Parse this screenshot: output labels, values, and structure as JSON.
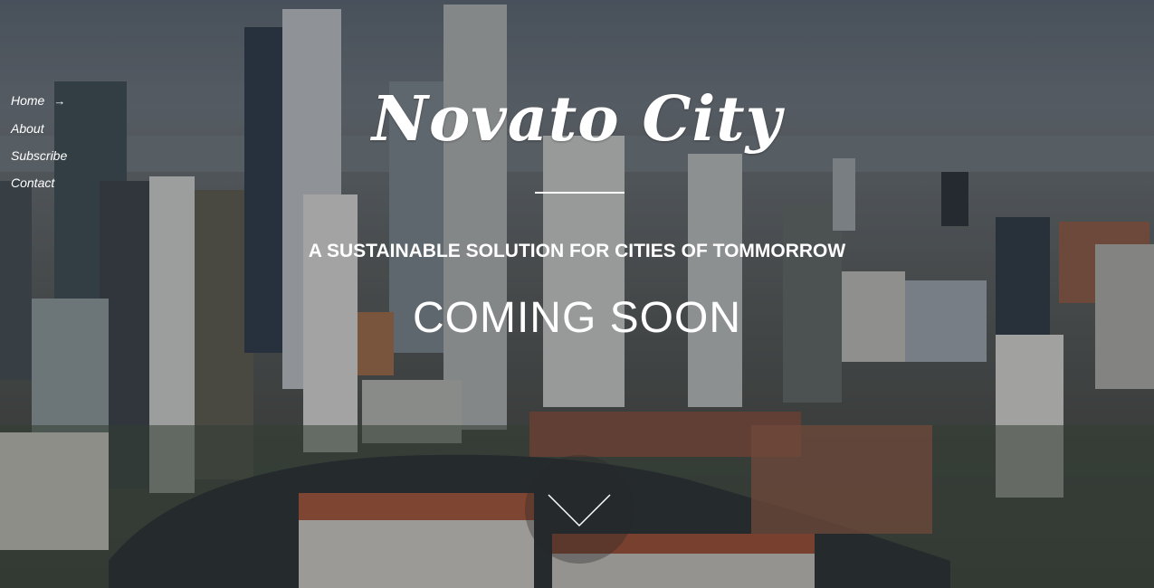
{
  "nav": {
    "items": [
      {
        "label": "Home",
        "active_arrow": "→"
      },
      {
        "label": "About"
      },
      {
        "label": "Subscribe"
      },
      {
        "label": "Contact"
      }
    ]
  },
  "hero": {
    "title": "Novato City",
    "tagline": "A SUSTAINABLE SOLUTION FOR CITIES OF TOMMORROW",
    "status": "COMING SOON"
  },
  "icons": {
    "scroll": "chevron-down-icon"
  },
  "colors": {
    "text": "#ffffff",
    "overlay": "#1f2329"
  }
}
